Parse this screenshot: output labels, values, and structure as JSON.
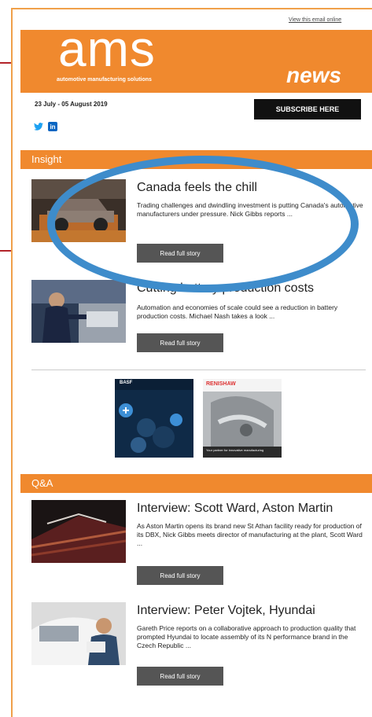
{
  "header": {
    "view_link": "View this email online",
    "logo_text": "ams",
    "tagline": "automotive manufacturing solutions",
    "news_label": "news",
    "date_range": "23 July - 05 August 2019",
    "subscribe_label": "SUBSCRIBE HERE"
  },
  "social": [
    {
      "icon": "twitter-icon",
      "glyph": "t",
      "color": "#1da1f2"
    },
    {
      "icon": "linkedin-icon",
      "glyph": "in",
      "color": "#0a66c2"
    }
  ],
  "sections": {
    "insight": "Insight",
    "qa": "Q&A"
  },
  "articles": [
    {
      "title": "Canada feels the chill",
      "summary": "Trading challenges and dwindling investment is putting Canada's automotive manufacturers under pressure. Nick Gibbs reports ...",
      "button": "Read full story"
    },
    {
      "title": "Cutting battery production costs",
      "summary": "Automation and economies of scale could see a reduction in battery production costs. Michael Nash takes a look ...",
      "button": "Read full story"
    },
    {
      "title": "Interview: Scott Ward, Aston Martin",
      "summary": "As Aston Martin opens its brand new St Athan facility ready for production of its DBX, Nick Gibbs meets director of manufacturing at the plant, Scott Ward ...",
      "button": "Read full story"
    },
    {
      "title": "Interview: Peter Vojtek, Hyundai",
      "summary": "Gareth Price reports on a collaborative approach to production quality that prompted Hyundai to locate assembly of its N performance brand in the Czech Republic ...",
      "button": "Read full story"
    }
  ],
  "ads": {
    "basf_logo": "BASF",
    "renishaw_logo": "RENISHAW",
    "renishaw_caption": "Your partner for innovative manufacturing"
  },
  "colors": {
    "brand_orange": "#f0892e",
    "annotation_blue": "#3e8ccb",
    "annotation_red": "#b3242a"
  }
}
